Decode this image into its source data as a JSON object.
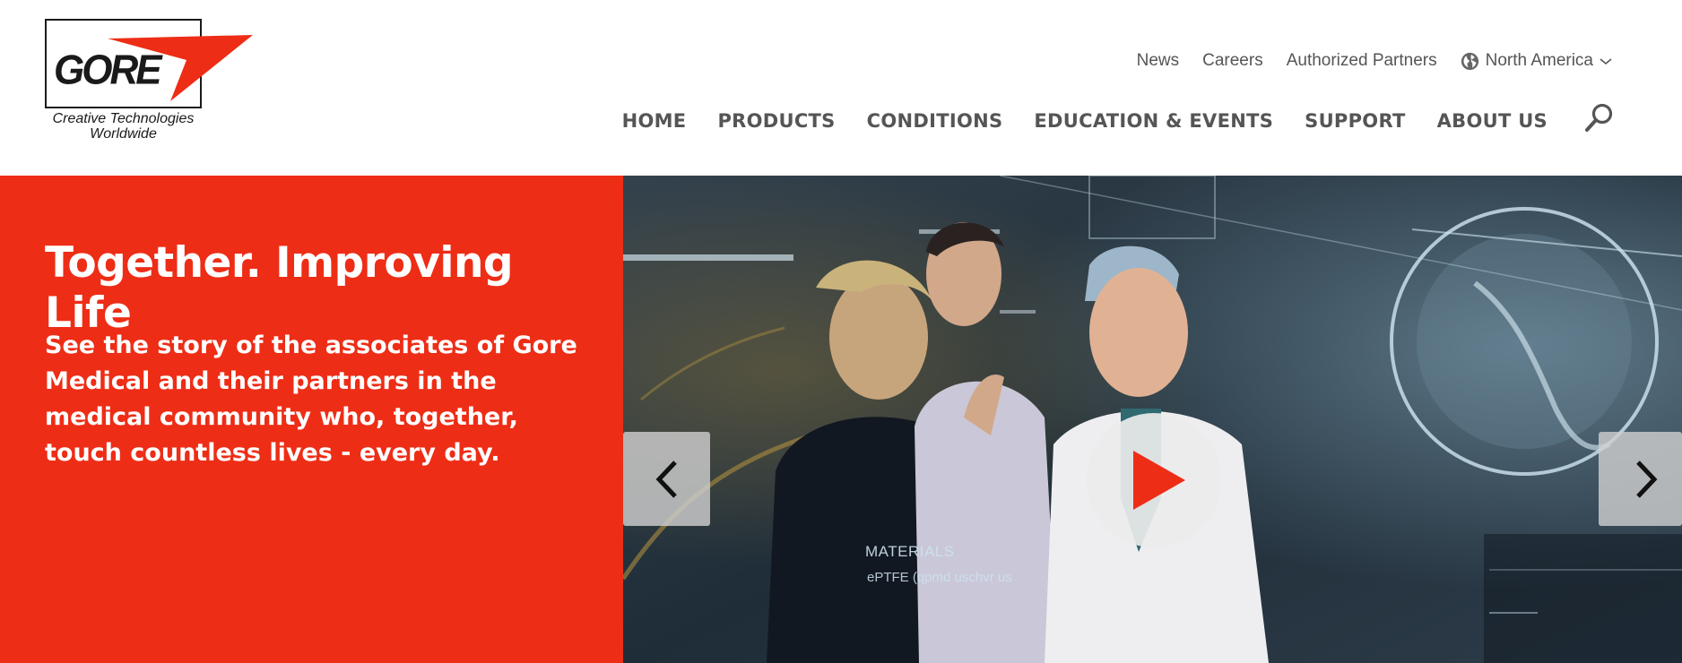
{
  "logo": {
    "wordmark": "GORE",
    "tagline_line1": "Creative Technologies",
    "tagline_line2": "Worldwide",
    "arrow_color": "#ee2d16"
  },
  "utility_nav": {
    "links": [
      "News",
      "Careers",
      "Authorized Partners"
    ],
    "region": {
      "icon": "globe-icon",
      "label": "North America",
      "dropdown_icon": "chevron-down-icon"
    }
  },
  "main_nav": {
    "items": [
      "HOME",
      "PRODUCTS",
      "CONDITIONS",
      "EDUCATION & EVENTS",
      "SUPPORT",
      "ABOUT US"
    ],
    "search_icon": "search-icon"
  },
  "hero": {
    "title": "Together. Improving Life",
    "text": "See the story of the associates of Gore Medical and their partners in the medical community who, together, touch countless lives - every day.",
    "background_color": "#ee2d16",
    "play_icon": "play-icon",
    "prev_icon": "chevron-left-icon",
    "next_icon": "chevron-right-icon",
    "screen_overlay_title": "MATERIALS",
    "screen_overlay_text": "ePTFE (qpmd uschvr us"
  }
}
